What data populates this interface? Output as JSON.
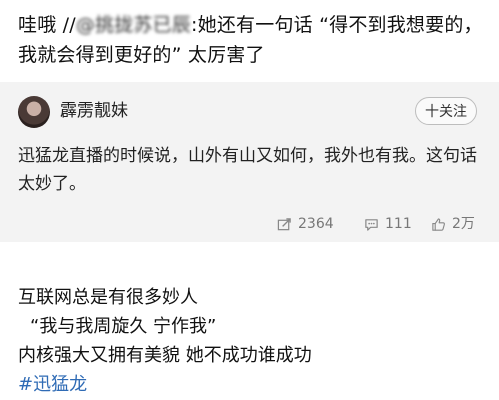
{
  "top_comment": {
    "prefix": "哇哦 //",
    "mention": "@挑拢苏已辰",
    "text": ":她还有一句话 “得不到我想要的，我就会得到更好的” 太厉害了"
  },
  "card": {
    "username": "霹雳靓妹",
    "follow_label": "十关注",
    "text": "迅猛龙直播的时候说，山外有山又如何，我外也有我。这句话太妙了。",
    "stats": {
      "repost": "2364",
      "comment": "111",
      "like": "2万"
    }
  },
  "post": {
    "lines": [
      "互联网总是有很多妙人",
      "“我与我周旋久 宁作我”",
      "内核强大又拥有美貌  她不成功谁成功"
    ],
    "hashtag": "#迅猛龙"
  }
}
